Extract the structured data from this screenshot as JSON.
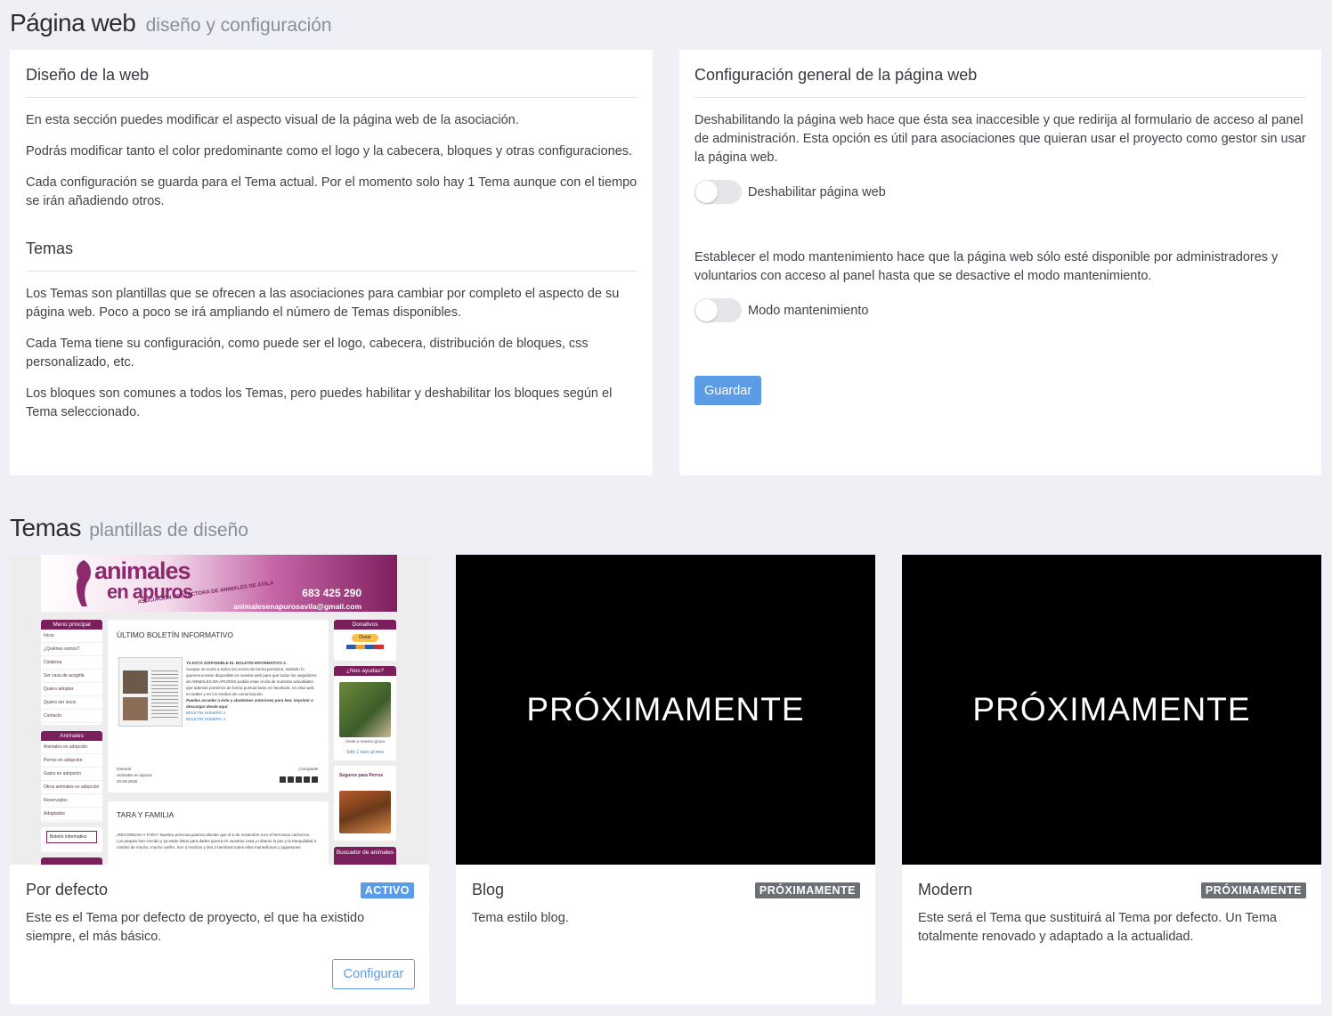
{
  "header": {
    "title": "Página web",
    "subtitle": "diseño y configuración"
  },
  "design": {
    "title": "Diseño de la web",
    "p1": "En esta sección puedes modificar el aspecto visual de la página web de la asociación.",
    "p2": "Podrás modificar tanto el color predominante como el logo y la cabecera, bloques y otras configuraciones.",
    "p3": "Cada configuración se guarda para el Tema actual. Por el momento solo hay 1 Tema aunque con el tiempo se irán añadiendo otros.",
    "themes_title": "Temas",
    "t1": "Los Temas son plantillas que se ofrecen a las asociaciones para cambiar por completo el aspecto de su página web. Poco a poco se irá ampliando el número de Temas disponibles.",
    "t2": "Cada Tema tiene su configuración, como puede ser el logo, cabecera, distribución de bloques, css personalizado, etc.",
    "t3": "Los bloques son comunes a todos los Temas, pero puedes habilitar y deshabilitar los bloques según el Tema seleccionado."
  },
  "config": {
    "title": "Configuración general de la página web",
    "p1": "Deshabilitando la página web hace que ésta sea inaccesible y que redirija al formulario de acceso al panel de administración. Esta opción es útil para asociaciones que quieran usar el proyecto como gestor sin usar la página web.",
    "toggle1_label": "Deshabilitar página web",
    "toggle1_on": false,
    "p2": "Establecer el modo mantenimiento hace que la página web sólo esté disponible por administradores y voluntarios con acceso al panel hasta que se desactive el modo mantenimiento.",
    "toggle2_label": "Modo mantenimiento",
    "toggle2_on": false,
    "save_label": "Guardar"
  },
  "themes_section": {
    "title": "Temas",
    "subtitle": "plantillas de diseño"
  },
  "themes": [
    {
      "name": "Por defecto",
      "badge": "ACTIVO",
      "badge_color": "#5c9ce6",
      "description": "Este es el Tema por defecto de proyecto, el que ha existido siempre, el más básico.",
      "button_label": "Configurar"
    },
    {
      "name": "Blog",
      "badge": "PRÓXIMAMENTE",
      "badge_color": "#6c7075",
      "preview_text": "PRÓXIMAMENTE",
      "description": "Tema estilo blog."
    },
    {
      "name": "Modern",
      "badge": "PRÓXIMAMENTE",
      "badge_color": "#6c7075",
      "preview_text": "PRÓXIMAMENTE",
      "description": "Este será el Tema que sustituirá al Tema por defecto. Un Tema totalmente renovado y adaptado a la actualidad."
    }
  ],
  "preview": {
    "logo_line1": "animales",
    "logo_line2": "en apuros",
    "assoc": "ASOCIACIÓN PROTECTORA DE ANIMALES DE ÁVILA",
    "phone": "683 425 290",
    "email": "animalesenapurosavila@gmail.com",
    "menu_title": "Menú principal",
    "menu_items": [
      "Inicio",
      "¿Quiénes somos?",
      "Colabora",
      "Ser casa de acogida",
      "Quiero adoptar",
      "Quiero ser socio",
      "Contacto"
    ],
    "animals_title": "Animales",
    "animals_items": [
      "Animales en adopción",
      "Perros en adopción",
      "Gatos en adopción",
      "Otros animales en adopción",
      "Reservados",
      "Adoptados"
    ],
    "newsletter_label": "Boletín informativo",
    "post1_title": "ÚLTIMO BOLETÍN INFORMATIVO",
    "post1_headline": "YA ESTÁ DISPONIBLE EL BOLETÍN INFORMATIVO 2.",
    "post1_body": "Aunque se envía a todos los socios de forma periódica, también lo queremos tener disponible en nuestra web para que todos los seguidores de ANIMALES EN APUROS podáis estar al día de nuestras actividades que además ponemos de forma puntual tanto en facebook, en esta web, en twitter y en los medios de comunicación.",
    "post1_cta": "Puedes acceder a éste y aboletines anteriores para leer, imprimir o descargar desde aquí:",
    "post1_link1": "BOLETÍN NÚMERO 2",
    "post1_link2": "BOLETÍN NÚMERO 1",
    "post1_meta1": "General",
    "post1_meta2": "Animales en apuros",
    "post1_meta3": "20-03-2018",
    "post1_share": "¡Comparte!",
    "post2_title": "TARA Y FAMILIA",
    "post2_body": "¡RECORDAIS A TARA? Nuestra preciosa pastora alemán que el 6 de noviembre tuvo 6 hermosos cachorros.",
    "post2_body2": "Los peques han crecido y ya están listos para darles guerra en vuestras casa y robaros la paz y la tranquilidad a cambio de mucho, mucho cariño. Son 4 machos y dos 2 hembras todos ellos maravillosos y juguetones.",
    "donate_title": "Donativos",
    "donate_btn": "Donar",
    "help_title": "¿Nos ayudas?",
    "help_caption": "Sólo 1 euro al mes",
    "teaming_caption": "Únete a nuestro grupo",
    "insure_title": "Seguros para Perros",
    "search_title": "Buscador de animales"
  }
}
